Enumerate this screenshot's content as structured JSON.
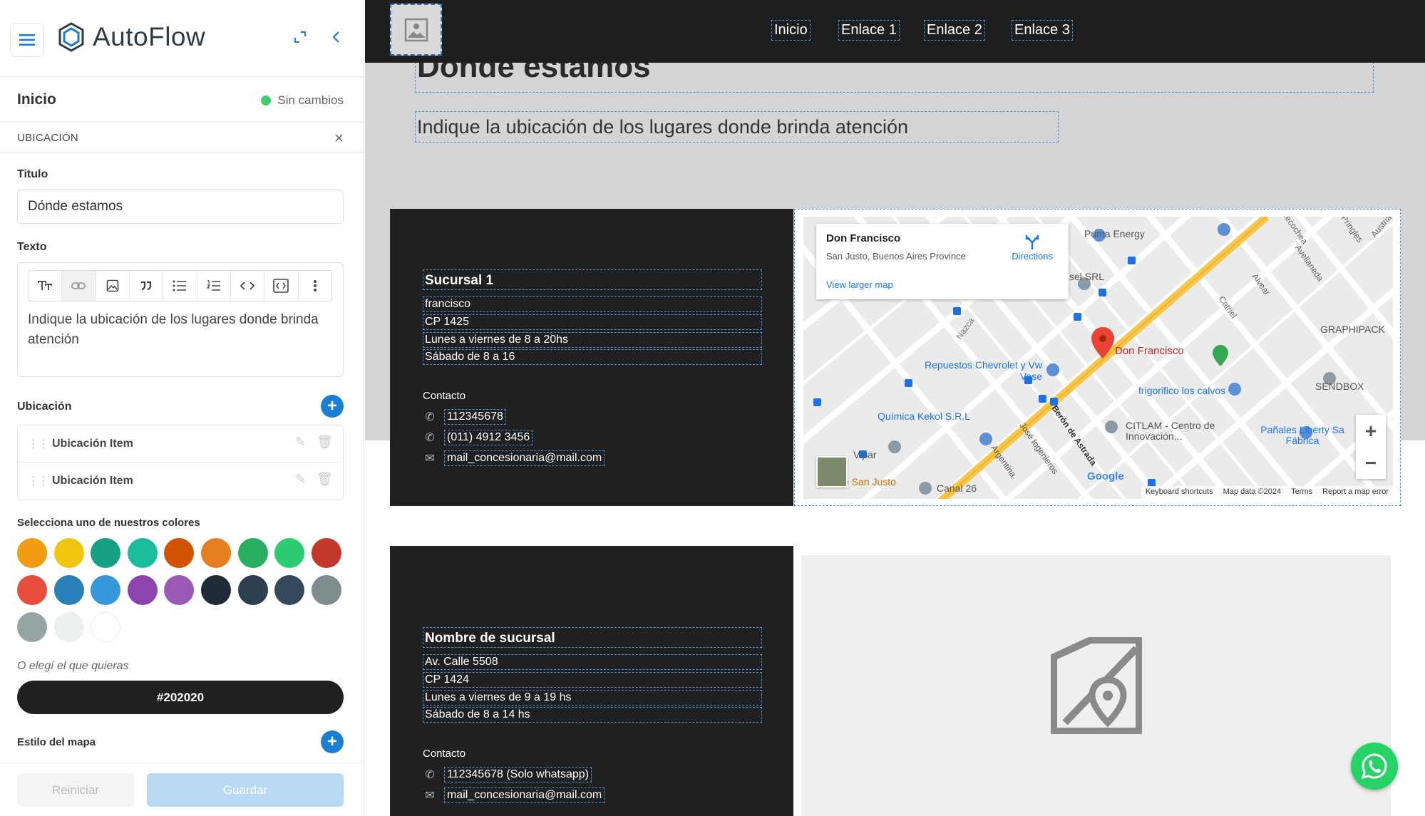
{
  "sidebar": {
    "brand": "AutoFlow",
    "page_title": "Inicio",
    "status": "Sin cambios",
    "section": "UBICACIÓN",
    "close_icon": "×",
    "title_label": "Titulo",
    "title_value": "Dónde estamos",
    "text_label": "Texto",
    "text_value": "Indique la ubicación de los lugares donde brinda atención",
    "toolbar_icons": [
      "text-size-icon",
      "link-icon",
      "image-icon",
      "quote-icon",
      "bullet-list-icon",
      "numbered-list-icon",
      "code-icon",
      "code-block-icon",
      "more-icon"
    ],
    "location_label": "Ubicación",
    "items": [
      {
        "label": "Ubicación Item"
      },
      {
        "label": "Ubicación Item"
      }
    ],
    "colors_label": "Selecciona uno de nuestros colores",
    "colors": [
      "#f39c12",
      "#f1c40f",
      "#16a085",
      "#1abc9c",
      "#d35400",
      "#e67e22",
      "#27ae60",
      "#2ecc71",
      "#c0392b",
      "#e74c3c",
      "#2980b9",
      "#3498db",
      "#8e44ad",
      "#9b59b6",
      "#1e2a36",
      "#2c3e50",
      "#34495e",
      "#7f8c8d",
      "#95a5a6",
      "#ecf0f1",
      "#ffffff"
    ],
    "custom_hint": "O elegí el que quieras",
    "custom_value": "#202020",
    "map_style_label": "Estilo del mapa",
    "reset_label": "Reiniciar",
    "save_label": "Guardar"
  },
  "preview": {
    "nav_links": [
      "Inicio",
      "Enlace 1",
      "Enlace 2",
      "Enlace 3"
    ],
    "heading": "Donde estamos",
    "subtext": "Indique la ubicación de los lugares donde brinda atención",
    "branch1": {
      "name": "Sucursal 1",
      "address": "francisco",
      "cp": "CP 1425",
      "hours1": "Lunes a viernes de 8 a 20hs",
      "hours2": "Sábado de 8 a 16",
      "contact_label": "Contacto",
      "phone1": "112345678",
      "phone2": "(011) 4912 3456",
      "email": "mail_concesionaria@mail.com"
    },
    "branch2": {
      "name": "Nombre de sucursal",
      "address": "Av. Calle 5508",
      "cp": "CP 1424",
      "hours1": "Lunes a viernes de 9 a 19 hs",
      "hours2": "Sábado de 8 a 14 hs",
      "contact_label": "Contacto",
      "phone1": "112345678 (Solo whatsapp)",
      "email": "mail_concesionaria@mail.com"
    },
    "map": {
      "place_name": "Don Francisco",
      "place_address": "San Justo, Buenos Aires Province",
      "directions": "Directions",
      "view_larger": "View larger map",
      "labels": [
        "Puma Energy",
        "Necochea",
        "Pringles",
        "Austria",
        "Avellaneda",
        "Alvear",
        "Catriel",
        "GRAPHIPACK",
        "sel SRL",
        "Nazca",
        "Repuestos Chevrolet y Vw Vese",
        "frigorifico los calvos",
        "SENDBOX",
        "Química Kekol S.R.L",
        "CITLAM - Centro de Innovación...",
        "Pañales Liberty Sa Fábrica",
        "Berón de Astrada",
        "José Ingenieros",
        "Argentina",
        "Canal 26",
        "e San Justo",
        "Vipar",
        "Google"
      ],
      "attribution": [
        "Keyboard shortcuts",
        "Map data ©2024",
        "Terms",
        "Report a map error"
      ]
    }
  }
}
